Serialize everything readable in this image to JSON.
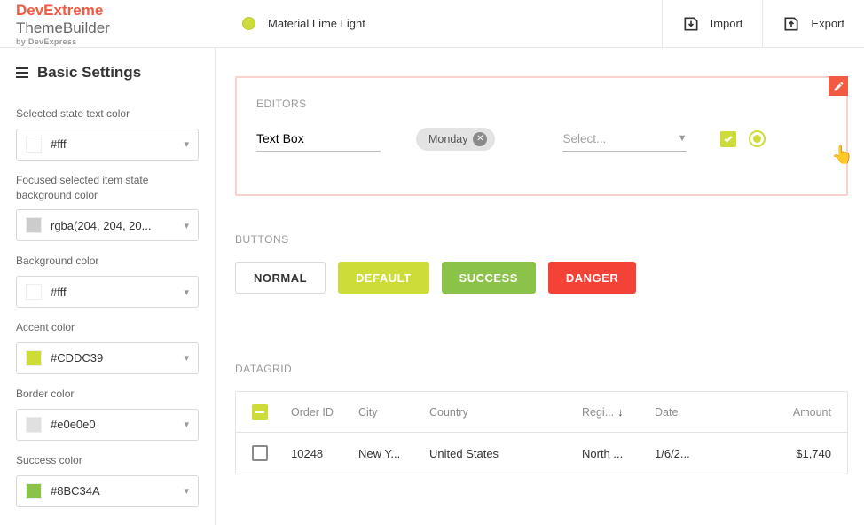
{
  "brand": {
    "part1": "DevExtreme",
    "part2": " ThemeBuilder",
    "sub": "by DevExpress"
  },
  "theme_name": "Material Lime Light",
  "top": {
    "import": "Import",
    "export": "Export"
  },
  "side_title": "Basic Settings",
  "settings": [
    {
      "label": "Selected state text color",
      "value": "#fff",
      "swatch": "#ffffff"
    },
    {
      "label": "Focused selected item state background color",
      "value": "rgba(204, 204, 20...",
      "swatch": "#cccccc"
    },
    {
      "label": "Background color",
      "value": "#fff",
      "swatch": "#ffffff"
    },
    {
      "label": "Accent color",
      "value": "#CDDC39",
      "swatch": "#CDDC39"
    },
    {
      "label": "Border color",
      "value": "#e0e0e0",
      "swatch": "#e0e0e0"
    },
    {
      "label": "Success color",
      "value": "#8BC34A",
      "swatch": "#8BC34A"
    }
  ],
  "sections": {
    "editors": "EDITORS",
    "buttons": "BUTTONS",
    "datagrid": "DATAGRID"
  },
  "editors": {
    "textbox": "Text Box",
    "chip": "Monday",
    "select_placeholder": "Select..."
  },
  "buttons": {
    "normal": "NORMAL",
    "default": "DEFAULT",
    "success": "SUCCESS",
    "danger": "DANGER"
  },
  "grid": {
    "headers": {
      "id": "Order ID",
      "city": "City",
      "country": "Country",
      "region": "Regi...",
      "date": "Date",
      "amount": "Amount"
    },
    "row": {
      "id": "10248",
      "city": "New Y...",
      "country": "United States",
      "region": "North ...",
      "date": "1/6/2...",
      "amount": "$1,740"
    }
  }
}
